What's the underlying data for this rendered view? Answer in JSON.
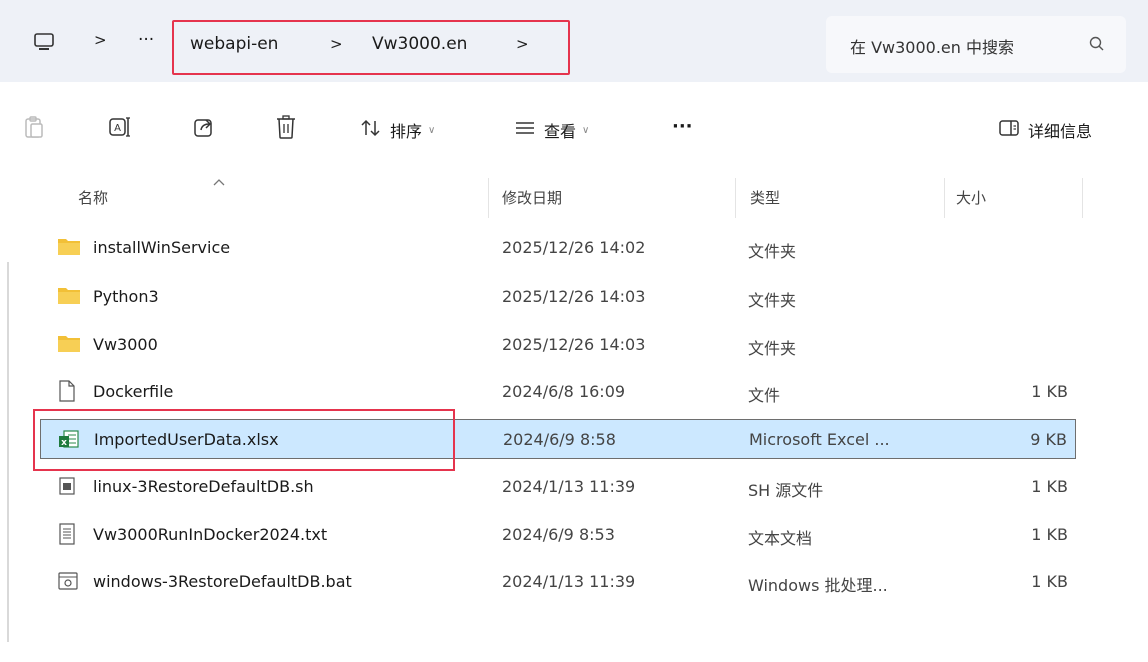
{
  "address_bar": {
    "segments": [
      "webapi-en",
      "Vw3000.en"
    ],
    "overflow_label": "···",
    "separator": ">"
  },
  "search": {
    "placeholder": "在 Vw3000.en 中搜索"
  },
  "toolbar": {
    "sort_label": "排序",
    "view_label": "查看",
    "more_label": "···",
    "details_label": "详细信息"
  },
  "columns": {
    "name": "名称",
    "date": "修改日期",
    "type": "类型",
    "size": "大小"
  },
  "files": [
    {
      "name": "installWinService",
      "date": "2025/12/26 14:02",
      "type": "文件夹",
      "size": "",
      "icon": "folder-icon"
    },
    {
      "name": "Python3",
      "date": "2025/12/26 14:03",
      "type": "文件夹",
      "size": "",
      "icon": "folder-icon"
    },
    {
      "name": "Vw3000",
      "date": "2025/12/26 14:03",
      "type": "文件夹",
      "size": "",
      "icon": "folder-icon"
    },
    {
      "name": "Dockerfile",
      "date": "2024/6/8 16:09",
      "type": "文件",
      "size": "1 KB",
      "icon": "blank-file-icon"
    },
    {
      "name": "ImportedUserData.xlsx",
      "date": "2024/6/9 8:58",
      "type": "Microsoft Excel ...",
      "size": "9 KB",
      "icon": "excel-file-icon",
      "selected": true
    },
    {
      "name": "linux-3RestoreDefaultDB.sh",
      "date": "2024/1/13 11:39",
      "type": "SH 源文件",
      "size": "1 KB",
      "icon": "script-file-icon"
    },
    {
      "name": "Vw3000RunInDocker2024.txt",
      "date": "2024/6/9 8:53",
      "type": "文本文档",
      "size": "1 KB",
      "icon": "text-file-icon"
    },
    {
      "name": "windows-3RestoreDefaultDB.bat",
      "date": "2024/1/13 11:39",
      "type": "Windows 批处理...",
      "size": "1 KB",
      "icon": "batch-file-icon"
    }
  ],
  "colors": {
    "selection_bg": "#cce8ff",
    "highlight_red": "#e5344d",
    "folder_yellow": "#f2c037",
    "topbar_bg": "#eef1f7"
  }
}
